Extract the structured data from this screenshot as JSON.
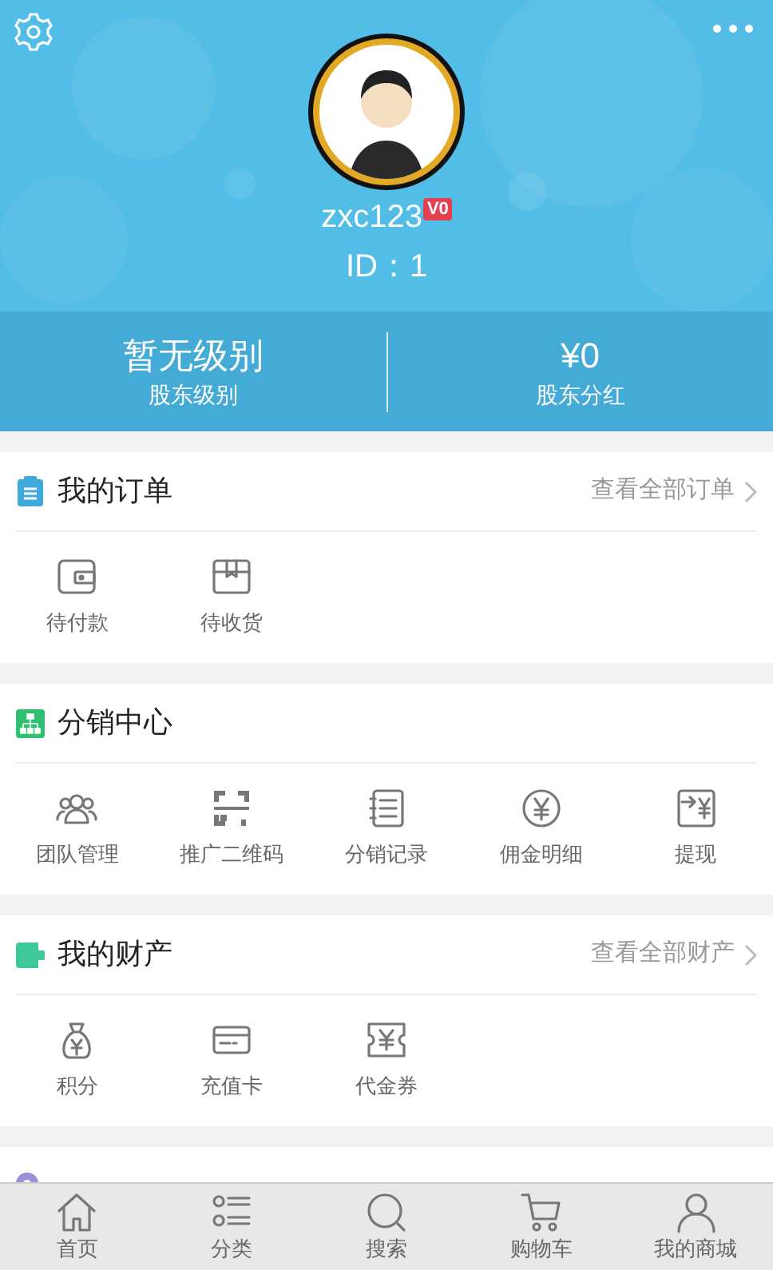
{
  "header": {
    "username": "zxc123",
    "badge": "V0",
    "user_id": "ID：1"
  },
  "stats": [
    {
      "value": "暂无级别",
      "label": "股东级别"
    },
    {
      "value": "¥0",
      "label": "股东分红"
    }
  ],
  "sections": [
    {
      "title": "我的订单",
      "link": "查看全部订单",
      "items": [
        "待付款",
        "待收货"
      ]
    },
    {
      "title": "分销中心",
      "items": [
        "团队管理",
        "推广二维码",
        "分销记录",
        "佣金明细",
        "提现"
      ]
    },
    {
      "title": "我的财产",
      "link": "查看全部财产",
      "items": [
        "积分",
        "充值卡",
        "代金券"
      ]
    }
  ],
  "tab_bar": [
    "首页",
    "分类",
    "搜索",
    "购物车",
    "我的商城"
  ]
}
